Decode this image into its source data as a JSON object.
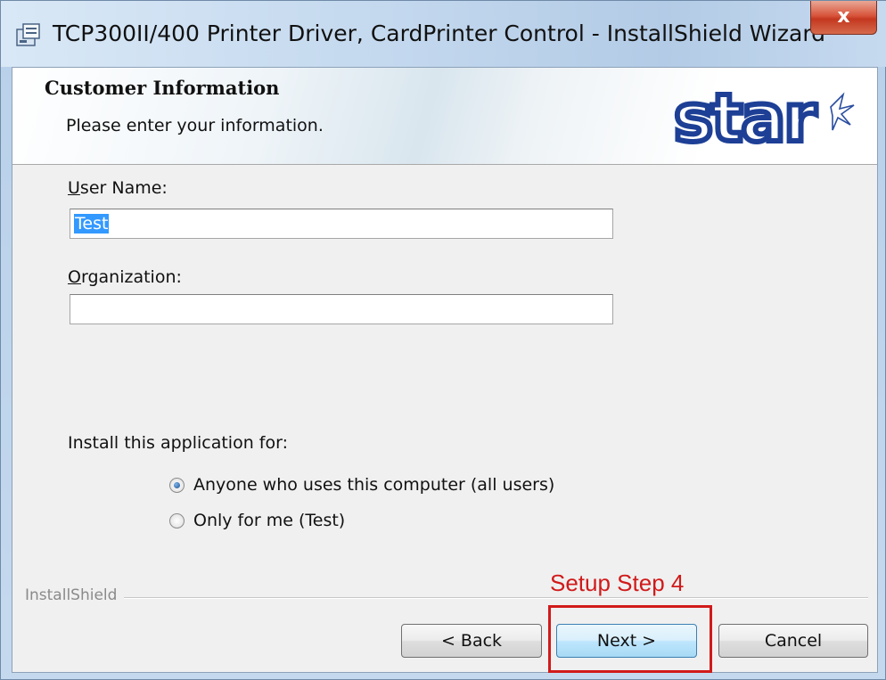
{
  "window": {
    "title": "TCP300II/400 Printer Driver, CardPrinter Control - InstallShield Wizard",
    "close_glyph": "x"
  },
  "banner": {
    "heading": "Customer Information",
    "subheading": "Please enter your information.",
    "logo_text": "star"
  },
  "form": {
    "user_name": {
      "label": "User Name:",
      "value": "Test"
    },
    "organization": {
      "label": "Organization:",
      "value": ""
    },
    "install_for": {
      "label": "Install this application for:",
      "options": [
        {
          "label": "Anyone who uses this computer (all users)",
          "selected": true
        },
        {
          "label": "Only for me (Test)",
          "selected": false
        }
      ]
    }
  },
  "footer": {
    "brand": "InstallShield",
    "back_label": "< Back",
    "next_label": "Next >",
    "cancel_label": "Cancel"
  },
  "annotation": {
    "text": "Setup Step 4",
    "color": "#d11a1a"
  }
}
